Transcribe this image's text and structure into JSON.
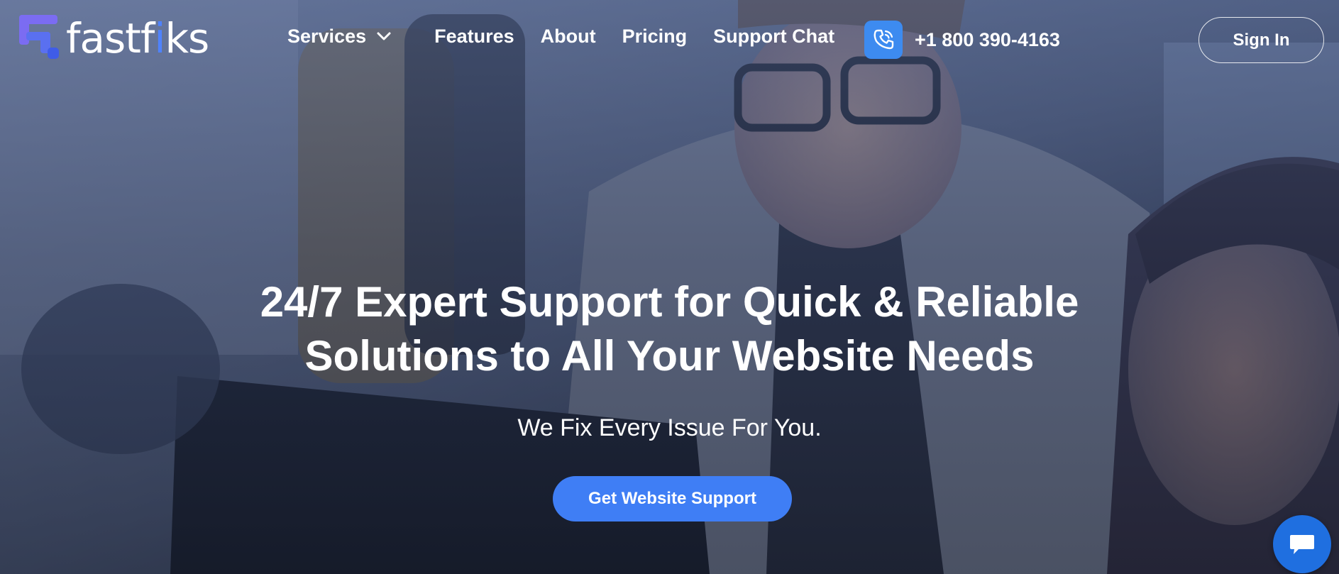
{
  "brand": {
    "logo_text_before": "fastf",
    "logo_text_accent": "i",
    "logo_text_after": "ks",
    "accent_color": "#4f83ff"
  },
  "nav": {
    "items": [
      {
        "label": "Services",
        "has_dropdown": true,
        "icon": "chevron-down-icon"
      },
      {
        "label": "Features"
      },
      {
        "label": "About"
      },
      {
        "label": "Pricing"
      },
      {
        "label": "Support Chat"
      }
    ]
  },
  "phone": {
    "icon": "phone-call-icon",
    "number": "+1 800 390-4163",
    "icon_color": "#3d8bf0"
  },
  "header": {
    "signin_label": "Sign In"
  },
  "hero": {
    "headline_line1": "24/7 Expert Support for Quick & Reliable",
    "headline_line2": "Solutions to All Your Website Needs",
    "subheadline": "We Fix Every Issue For You.",
    "cta_label": "Get Website Support",
    "cta_color": "#3f7ef5"
  },
  "chat_widget": {
    "icon": "chat-bubble-icon",
    "color": "#1f6fe0"
  }
}
